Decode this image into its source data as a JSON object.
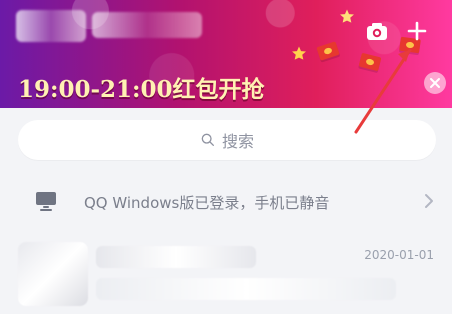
{
  "header": {
    "promo_text": "19:00-21:00红包开抢"
  },
  "search": {
    "placeholder": "搜索"
  },
  "device_notice": {
    "text": "QQ Windows版已登录，手机已静音"
  },
  "conversations": [
    {
      "date": "2020-01-01"
    }
  ],
  "colors": {
    "annotation_arrow": "#e83b3b",
    "header_gradient_start": "#6b1aa7",
    "header_gradient_end": "#ff3aa0"
  },
  "icons": {
    "camera": "camera-icon",
    "plus": "plus-icon",
    "close": "close-icon",
    "search": "search-icon",
    "device": "monitor-icon",
    "chevron": "chevron-right-icon"
  }
}
